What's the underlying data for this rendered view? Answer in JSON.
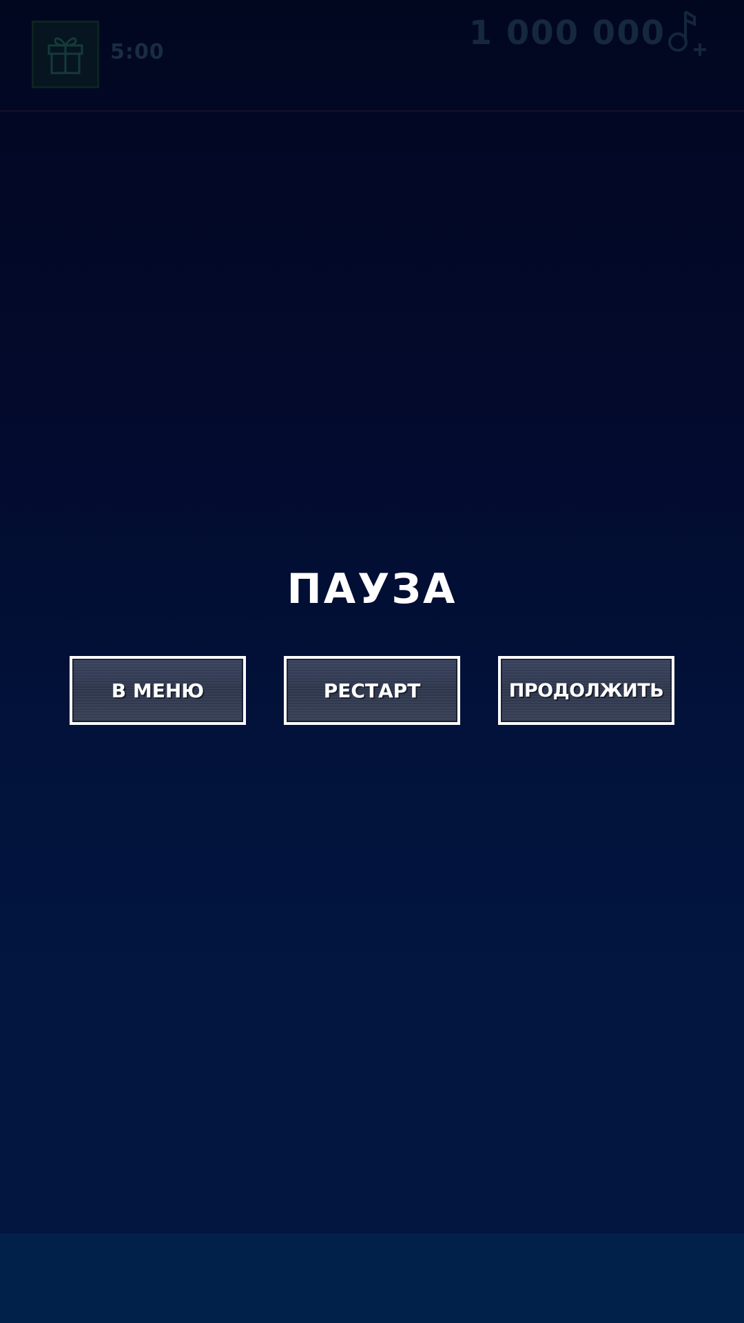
{
  "top_bar": {
    "timer": "5:00",
    "currency_value": "1 000 000",
    "gift_icon": "gift-icon",
    "music_add_icon": "music-note-plus-icon"
  },
  "pause_menu": {
    "title": "ПАУЗА",
    "buttons": {
      "menu": "В МЕНЮ",
      "restart": "РЕСТАРТ",
      "continue": "ПРОДОЛЖИТЬ"
    }
  },
  "colors": {
    "background_top": "#020720",
    "background_bottom": "#021640",
    "bottom_band": "#01214a",
    "button_border": "#ffffff",
    "button_fill": "#343d55",
    "title_text": "#ffffff"
  }
}
